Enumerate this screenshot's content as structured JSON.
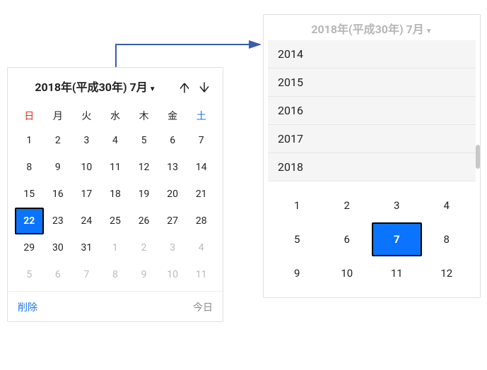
{
  "left": {
    "title": "2018年(平成30年) 7月",
    "dow": [
      "日",
      "月",
      "火",
      "水",
      "木",
      "金",
      "土"
    ],
    "rows": [
      [
        {
          "n": "1"
        },
        {
          "n": "2"
        },
        {
          "n": "3"
        },
        {
          "n": "4"
        },
        {
          "n": "5"
        },
        {
          "n": "6"
        },
        {
          "n": "7"
        }
      ],
      [
        {
          "n": "8"
        },
        {
          "n": "9"
        },
        {
          "n": "10"
        },
        {
          "n": "11"
        },
        {
          "n": "12"
        },
        {
          "n": "13"
        },
        {
          "n": "14"
        }
      ],
      [
        {
          "n": "15"
        },
        {
          "n": "16"
        },
        {
          "n": "17"
        },
        {
          "n": "18"
        },
        {
          "n": "19"
        },
        {
          "n": "20"
        },
        {
          "n": "21"
        }
      ],
      [
        {
          "n": "22",
          "selected": true
        },
        {
          "n": "23"
        },
        {
          "n": "24"
        },
        {
          "n": "25"
        },
        {
          "n": "26"
        },
        {
          "n": "27"
        },
        {
          "n": "28"
        }
      ],
      [
        {
          "n": "29"
        },
        {
          "n": "30"
        },
        {
          "n": "31"
        },
        {
          "n": "1",
          "other": true
        },
        {
          "n": "2",
          "other": true
        },
        {
          "n": "3",
          "other": true
        },
        {
          "n": "4",
          "other": true
        }
      ],
      [
        {
          "n": "5",
          "other": true
        },
        {
          "n": "6",
          "other": true
        },
        {
          "n": "7",
          "other": true
        },
        {
          "n": "8",
          "other": true
        },
        {
          "n": "9",
          "other": true
        },
        {
          "n": "10",
          "other": true
        },
        {
          "n": "11",
          "other": true
        }
      ]
    ],
    "delete_label": "削除",
    "today_label": "今日"
  },
  "right": {
    "title": "2018年(平成30年) 7月",
    "years": [
      "2014",
      "2015",
      "2016",
      "2017",
      "2018"
    ],
    "months": [
      "1",
      "2",
      "3",
      "4",
      "5",
      "6",
      "7",
      "8",
      "9",
      "10",
      "11",
      "12"
    ],
    "selected_month": "7"
  }
}
